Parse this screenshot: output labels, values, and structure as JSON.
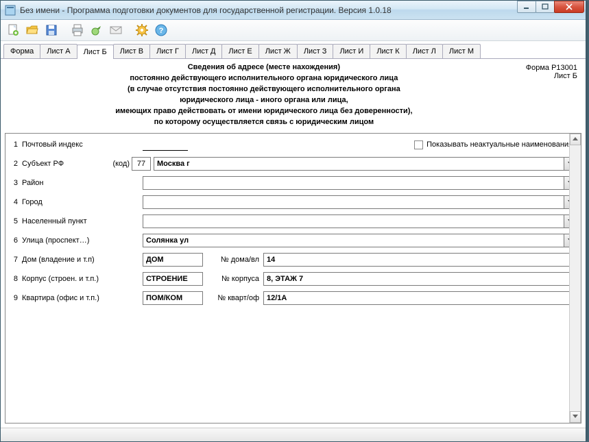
{
  "window": {
    "title": "Без имени - Программа подготовки документов для государственной регистрации. Версия 1.0.18"
  },
  "tabs": [
    {
      "label": "Форма"
    },
    {
      "label": "Лист А"
    },
    {
      "label": "Лист Б"
    },
    {
      "label": "Лист В"
    },
    {
      "label": "Лист Г"
    },
    {
      "label": "Лист Д"
    },
    {
      "label": "Лист Е"
    },
    {
      "label": "Лист Ж"
    },
    {
      "label": "Лист З"
    },
    {
      "label": "Лист И"
    },
    {
      "label": "Лист К"
    },
    {
      "label": "Лист Л"
    },
    {
      "label": "Лист М"
    }
  ],
  "form_right": {
    "line1": "Форма Р13001",
    "line2": "Лист Б"
  },
  "heading": {
    "l1": "Сведения об адресе (месте нахождения)",
    "l2": "постоянно действующего исполнительного органа юридического лица",
    "l3": "(в случае отсутствия постоянно действующего исполнительного органа",
    "l4": "юридического лица - иного органа или лица,",
    "l5": "имеющих право действовать от имени юридического лица без доверенности),",
    "l6": "по которому осуществляется связь с юридическим лицом"
  },
  "checkbox_label": "Показывать неактуальные наименования",
  "rows": {
    "r1": {
      "num": "1",
      "label": "Почтовый индекс",
      "value": ""
    },
    "r2": {
      "num": "2",
      "label": "Субъект РФ",
      "kod": "(код)",
      "code": "77",
      "value": "Москва г"
    },
    "r3": {
      "num": "3",
      "label": "Район",
      "value": ""
    },
    "r4": {
      "num": "4",
      "label": "Город",
      "value": ""
    },
    "r5": {
      "num": "5",
      "label": "Населенный пункт",
      "value": ""
    },
    "r6": {
      "num": "6",
      "label": "Улица (проспект…)",
      "value": "Солянка ул"
    },
    "r7": {
      "num": "7",
      "label": "Дом (владение и т.п)",
      "type": "ДОМ",
      "sub": "№ дома/вл",
      "value": "14"
    },
    "r8": {
      "num": "8",
      "label": "Корпус (строен. и т.п.)",
      "type": "СТРОЕНИЕ",
      "sub": "№ корпуса",
      "value": "8, ЭТАЖ 7"
    },
    "r9": {
      "num": "9",
      "label": "Квартира (офис и т.п.)",
      "type": "ПОМ/КОМ",
      "sub": "№ кварт/оф",
      "value": "12/1А"
    }
  }
}
